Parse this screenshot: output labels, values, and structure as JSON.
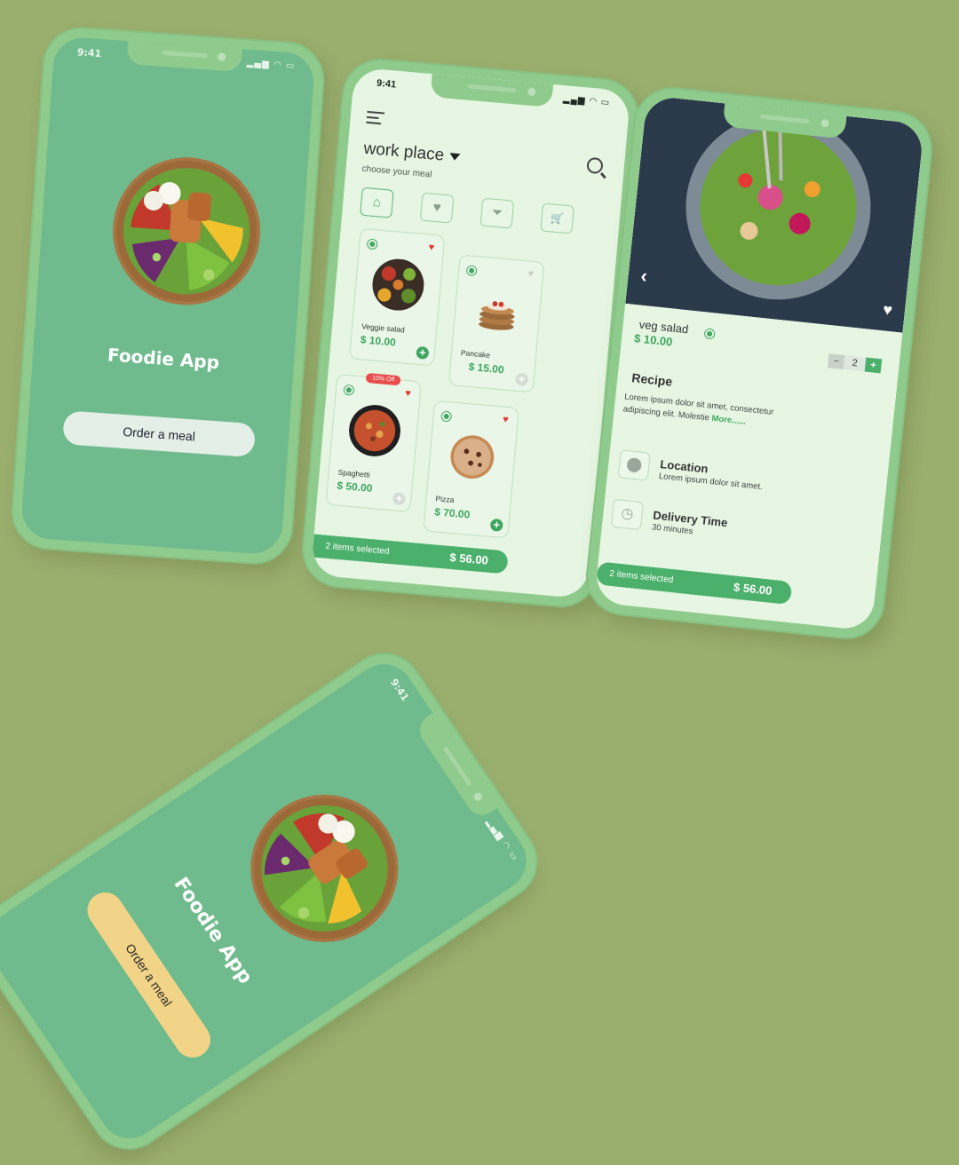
{
  "colors": {
    "background": "#9aae6e",
    "phone_frame": "#8fcb8c",
    "splash_screen": "#6fbb8d",
    "light_screen": "#e6f6e3",
    "accent_green": "#43a764",
    "sale_red": "#e84c4c",
    "button_yellow": "#f2d488"
  },
  "status_bar": {
    "time": "9:41",
    "icons": [
      "signal-icon",
      "wifi-icon",
      "battery-icon"
    ]
  },
  "splash": {
    "title": "Foodie App",
    "order_button": "Order a meal"
  },
  "menu": {
    "location": "work place",
    "subtitle": "choose your meal",
    "categories": [
      {
        "icon": "home-icon",
        "glyph": "⌂"
      },
      {
        "icon": "heart-icon",
        "glyph": "♥"
      },
      {
        "icon": "filter-icon",
        "glyph": "⏷"
      },
      {
        "icon": "cart-icon",
        "glyph": "🛒"
      }
    ],
    "items": [
      {
        "name": "Veggie salad",
        "price": "$ 10.00",
        "favorite": true,
        "selected": true,
        "badge": ""
      },
      {
        "name": "Pancake",
        "price": "$ 15.00",
        "favorite": false,
        "selected": true,
        "badge": ""
      },
      {
        "name": "Spaghetti",
        "price": "$ 50.00",
        "favorite": true,
        "selected": true,
        "badge": "10% Off"
      },
      {
        "name": "Pizza",
        "price": "$ 70.00",
        "favorite": true,
        "selected": true,
        "badge": ""
      }
    ],
    "cart_bar": {
      "count_label": "2 items selected",
      "total": "$ 56.00"
    }
  },
  "detail": {
    "name": "veg salad",
    "price": "$ 10.00",
    "quantity": "2",
    "recipe_heading": "Recipe",
    "recipe_text": "Lorem ipsum dolor sit amet, consectetur adipiscing elit. Molestie",
    "more_link": "More......",
    "location_heading": "Location",
    "location_text": "Lorem ipsum dolor sit amet.",
    "delivery_heading": "Delivery Time",
    "delivery_text": "30 minutes",
    "cart_bar": {
      "count_label": "2 items selected",
      "total": "$ 56.00"
    }
  },
  "splash_alt": {
    "title": "Foodie App",
    "order_button": "Order a meal"
  }
}
